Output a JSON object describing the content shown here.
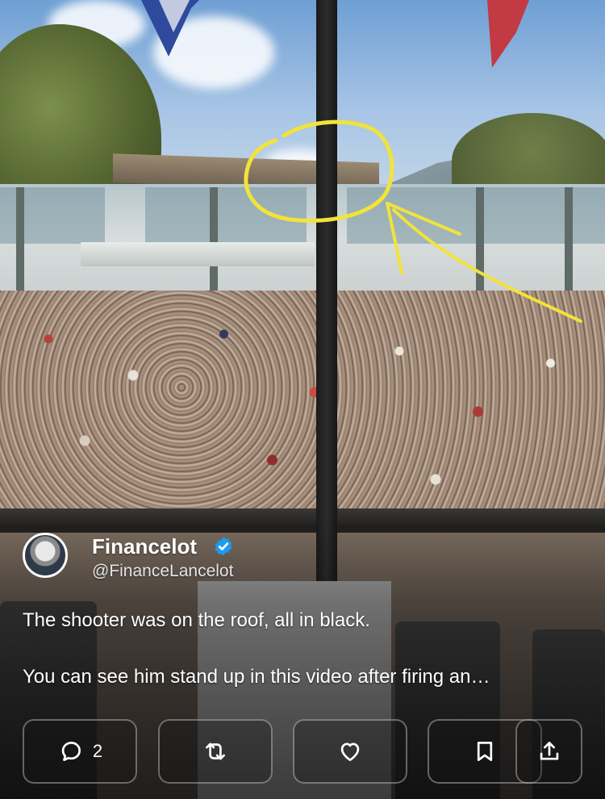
{
  "tweet": {
    "author_name": "Financelot",
    "author_handle": "@FinanceLancelot",
    "verified": true,
    "text_line1": "The shooter was on the roof, all in black.",
    "text_line2": "You can see him stand up in this video after firing an…"
  },
  "actions": {
    "reply": {
      "icon": "comment-icon",
      "count": "2"
    },
    "repost": {
      "icon": "repost-icon"
    },
    "like": {
      "icon": "heart-icon"
    },
    "bookmark": {
      "icon": "bookmark-icon"
    },
    "share": {
      "icon": "share-icon"
    }
  },
  "colors": {
    "verified_badge": "#1d9bf0",
    "annotation": "#f2e33a",
    "text": "#ffffff"
  }
}
